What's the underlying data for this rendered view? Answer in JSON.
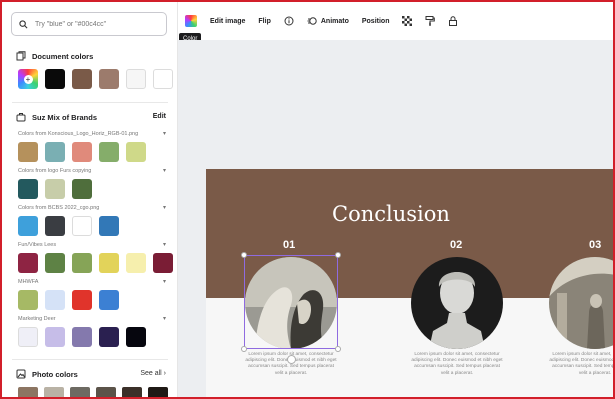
{
  "sidebar": {
    "search_placeholder": "Try \"blue\" or \"#00c4cc\"",
    "document_colors": {
      "title": "Document colors",
      "swatches": [
        "rainbow",
        "#0a0a0a",
        "#7a5a48",
        "#9c7b6c",
        "#f6f6f6",
        "#ffffff"
      ]
    },
    "brand_kit": {
      "title": "Suz Mix of Brands",
      "edit_label": "Edit",
      "palettes": [
        {
          "label": "Colors from Konscious_Logo_Horiz_RGB-01.png",
          "colors": [
            "#b5915c",
            "#7aafb3",
            "#e08a7b",
            "#85ad6a",
            "#cfd989"
          ]
        },
        {
          "label": "Colors from logo Furs copying",
          "colors": [
            "#23595e",
            "#c7cda9",
            "#4f6e3c"
          ]
        },
        {
          "label": "Colors from BCBS 2022_cgo.png",
          "colors": [
            "#3ea0db",
            "#3a3d42",
            "#ffffff",
            "#3278b7"
          ]
        },
        {
          "label": "Fun/Vibes Lees",
          "colors": [
            "#8e2443",
            "#5e8245",
            "#86a457",
            "#e2d35a",
            "#f6efad",
            "#7a1d35"
          ]
        },
        {
          "label": "MHWFA",
          "colors": [
            "#a6b965",
            "#d5e2f7",
            "#e0342b",
            "#3c80d3"
          ]
        },
        {
          "label": "Marketing Deer",
          "colors": [
            "#efeff7",
            "#c6bde8",
            "#8479ad",
            "#2a2050",
            "#06060e"
          ]
        }
      ]
    },
    "photo_colors": {
      "title": "Photo colors",
      "see_all_label": "See all",
      "colors": [
        "#8c7562",
        "#b9b2a5",
        "#6d6a62",
        "#5b5349",
        "#3b3029",
        "#1f1915"
      ]
    }
  },
  "toolbar": {
    "color_tooltip": "Color",
    "edit_image_label": "Edit image",
    "flip_label": "Flip",
    "animate_label": "Animato",
    "position_label": "Position"
  },
  "slide": {
    "title": "Conclusion",
    "items": [
      {
        "number": "01",
        "description": "Lorem ipsum dolor sit amet, consectetur adipiscing elit. Donec euismod et nibh eget accumsan suscipit. Sed tempus placerat velit a placerat."
      },
      {
        "number": "02",
        "description": "Lorem ipsum dolor sit amet, consectetur adipiscing elit. Donec euismod et nibh eget accumsan suscipit. Sed tempus placerat velit a placerat."
      },
      {
        "number": "03",
        "description": "Lorem ipsum dolor sit amet, consectetur adipiscing elit. Donec euismod et nibh eget accumsan suscipit. Sed tempus placerat velit a placerat."
      }
    ]
  },
  "colors": {
    "accent": "#8f6be0",
    "slide_brown": "#7a5a48"
  }
}
